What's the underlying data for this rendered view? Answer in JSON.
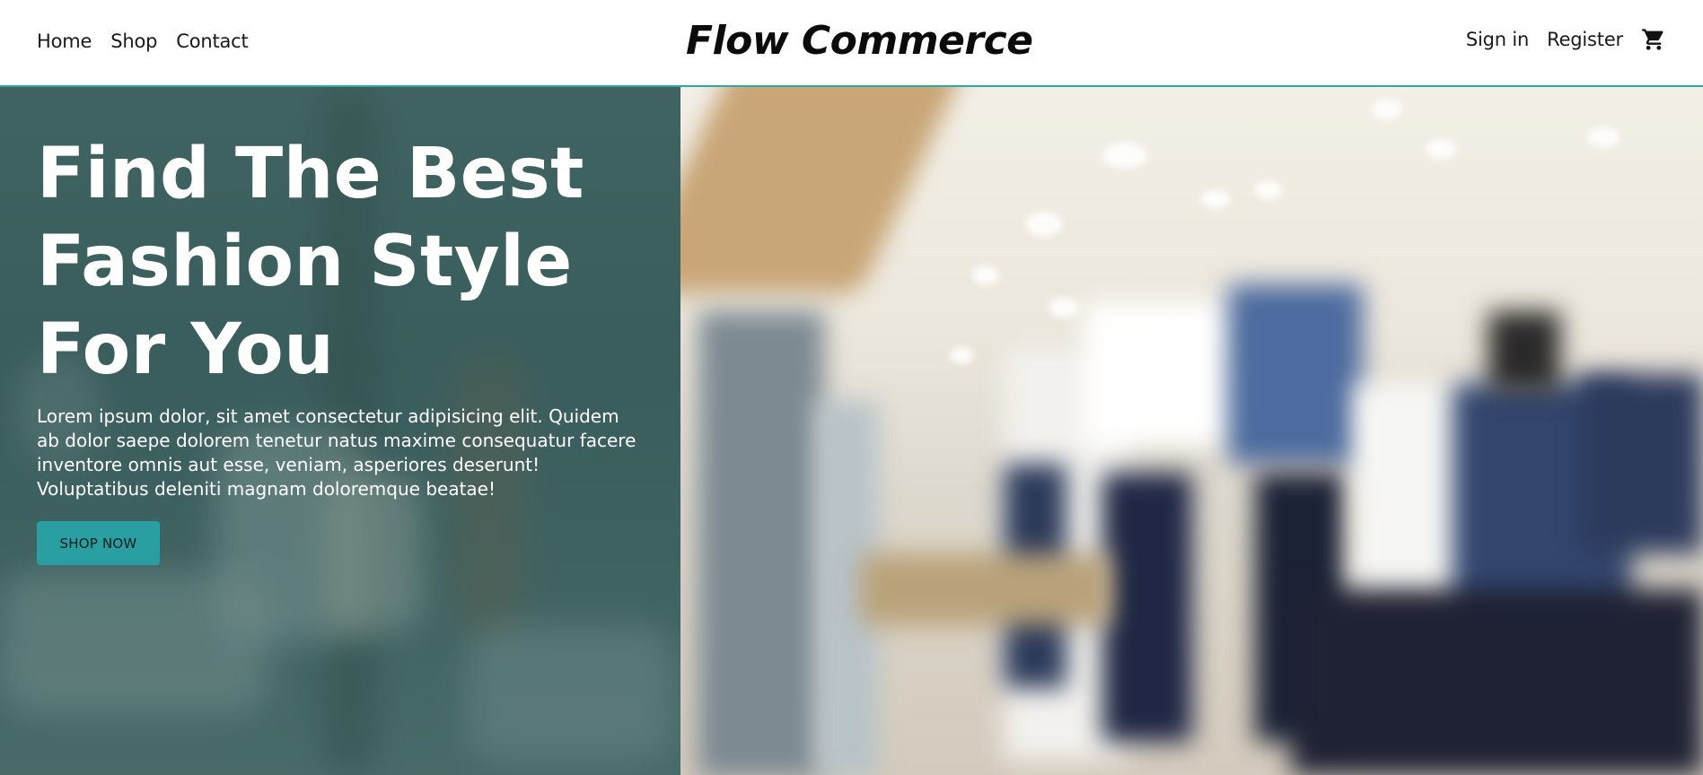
{
  "header": {
    "nav_left": [
      "Home",
      "Shop",
      "Contact"
    ],
    "logo": "Flow Commerce",
    "nav_right": {
      "signin": "Sign in",
      "register": "Register"
    },
    "cart_icon": "shopping-cart-icon"
  },
  "hero": {
    "title": "Find The Best Fashion Style For You",
    "text": "Lorem ipsum dolor, sit amet consectetur adipisicing elit. Quidem ab dolor saepe dolorem tenetur natus maxime consequatur facere inventore omnis aut esse, veniam, asperiores deserunt! Voluptatibus deleniti magnam doloremque beatae!",
    "button": "SHOP NOW",
    "image": "blurred clothing store background"
  },
  "colors": {
    "accent": "#2aa9a9",
    "button_bg": "#2a9fa2",
    "overlay": "#285454",
    "header_bg": "#ffffff"
  }
}
